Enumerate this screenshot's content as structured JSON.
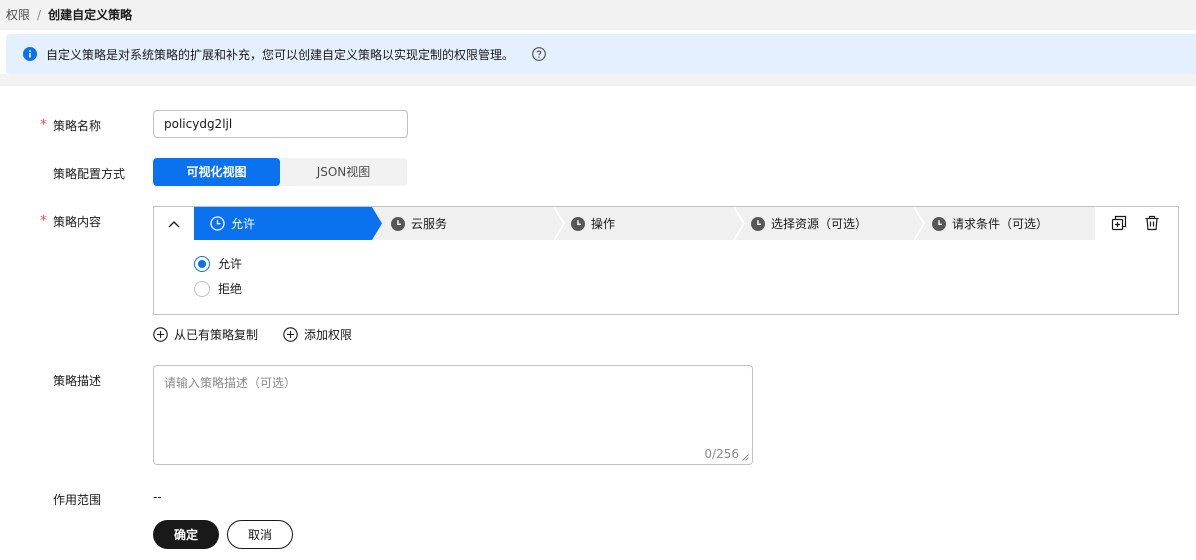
{
  "breadcrumb": {
    "parent": "权限",
    "separator": "/",
    "current": "创建自定义策略"
  },
  "notice": {
    "text": "自定义策略是对系统策略的扩展和补充，您可以创建自定义策略以实现定制的权限管理。"
  },
  "form": {
    "name": {
      "label": "策略名称",
      "value": "policydg2ljl"
    },
    "config": {
      "label": "策略配置方式",
      "options": [
        "可视化视图",
        "JSON视图"
      ],
      "selected": "可视化视图"
    },
    "content": {
      "label": "策略内容",
      "steps": [
        "允许",
        "云服务",
        "操作",
        "选择资源（可选）",
        "请求条件（可选）"
      ],
      "active_step": "允许",
      "effect_options": [
        "允许",
        "拒绝"
      ],
      "effect_selected": "允许"
    },
    "actions": {
      "copy_label": "从已有策略复制",
      "add_label": "添加权限"
    },
    "description": {
      "label": "策略描述",
      "placeholder": "请输入策略描述（可选）",
      "counter": "0/256"
    },
    "scope": {
      "label": "作用范围",
      "value": "--"
    }
  },
  "buttons": {
    "confirm": "确定",
    "cancel": "取消"
  },
  "colors": {
    "accent": "#0a71ef",
    "required": "#e84e4e",
    "notice_bg": "#e5f0ff",
    "primary_button": "#191919"
  },
  "icons": [
    "info-icon",
    "help-icon",
    "chevron-up-icon",
    "clock-icon",
    "copy-icon",
    "trash-icon",
    "plus-circle-icon",
    "resize-handle-icon"
  ]
}
